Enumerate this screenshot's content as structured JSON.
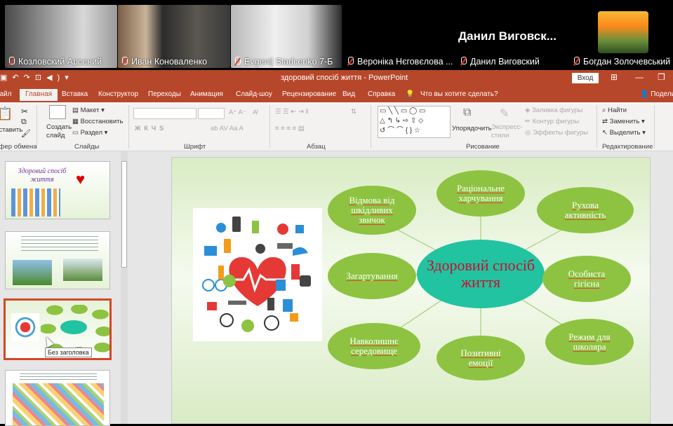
{
  "participants": [
    {
      "name": "Козловский Арсений"
    },
    {
      "name": "Иван Коноваленко"
    },
    {
      "name": "Evgenij Stadcenko 7-Б"
    },
    {
      "name": "Вероніка Нєговєлова ..."
    },
    {
      "name": "Данил Виговский",
      "display": "Данил  Виговск..."
    },
    {
      "name": "Богдан Золочевський"
    }
  ],
  "window": {
    "title": "здоровий спосіб життя  -  PowerPoint",
    "login": "Вход"
  },
  "tabs": [
    "Файл",
    "Главная",
    "Вставка",
    "Конструктор",
    "Переходы",
    "Анимация",
    "Слайд-шоу",
    "Рецензирование",
    "Вид",
    "Справка"
  ],
  "tell_me": "Что вы хотите сделать?",
  "share": "Поделиться",
  "ribbon": {
    "paste": "Вставить",
    "clipboard": "Буфер обмена",
    "new_slide": "Создать слайд",
    "layout": "Макет",
    "reset": "Восстановить",
    "section": "Раздел",
    "slides": "Слайды",
    "font": "Шрифт",
    "font_buttons": "Ж  К  Ч  S",
    "paragraph": "Абзац",
    "arrange": "Упорядочить",
    "quick_styles": "Экспресс-стили",
    "shape_fill": "Заливка фигуры",
    "shape_outline": "Контур фигуры",
    "shape_effects": "Эффекты фигуры",
    "drawing": "Рисование",
    "find": "Найти",
    "replace": "Заменить",
    "select": "Выделить",
    "editing": "Редактирование"
  },
  "thumbnails": {
    "slide1_title": "Здоровий спосіб життя",
    "tooltip": "Без заголовка"
  },
  "slide": {
    "center": "Здоровий спосіб життя",
    "ovals": [
      "Відмова від шкідливих звичок",
      "Раціональне харчування",
      "Рухова активність",
      "Загартування",
      "Особиста гігієна",
      "Навколишнє середовище",
      "Позитивні емоції",
      "Режим для школяра"
    ]
  },
  "colors": {
    "ppt_accent": "#b7472a",
    "oval_green": "#8dc340",
    "center_teal": "#22c3a0",
    "center_text": "#c8102e",
    "muted_mic": "#e32222"
  }
}
